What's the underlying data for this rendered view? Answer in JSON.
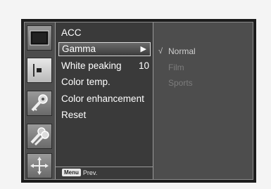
{
  "menu": {
    "items": [
      {
        "label": "ACC",
        "value": "",
        "selected": false
      },
      {
        "label": "Gamma",
        "value": "",
        "selected": true
      },
      {
        "label": "White peaking",
        "value": "10",
        "selected": false
      },
      {
        "label": "Color temp.",
        "value": "",
        "selected": false
      },
      {
        "label": "Color enhancement",
        "value": "",
        "selected": false
      },
      {
        "label": "Reset",
        "value": "",
        "selected": false
      }
    ],
    "arrow": "▶",
    "footer": {
      "key": "Menu",
      "text": "Prev."
    }
  },
  "submenu": {
    "options": [
      {
        "label": "Normal",
        "checked": true
      },
      {
        "label": "Film",
        "checked": false
      },
      {
        "label": "Sports",
        "checked": false
      }
    ],
    "check": "√"
  },
  "icons": [
    "screen-icon",
    "picture-icon",
    "key-icon",
    "keys-icon",
    "move-icon"
  ],
  "colors": {
    "panel": "#3a3a3a",
    "background": "#4d4d4d",
    "text": "#ffffff",
    "inactive_text": "#7c7c7c"
  }
}
